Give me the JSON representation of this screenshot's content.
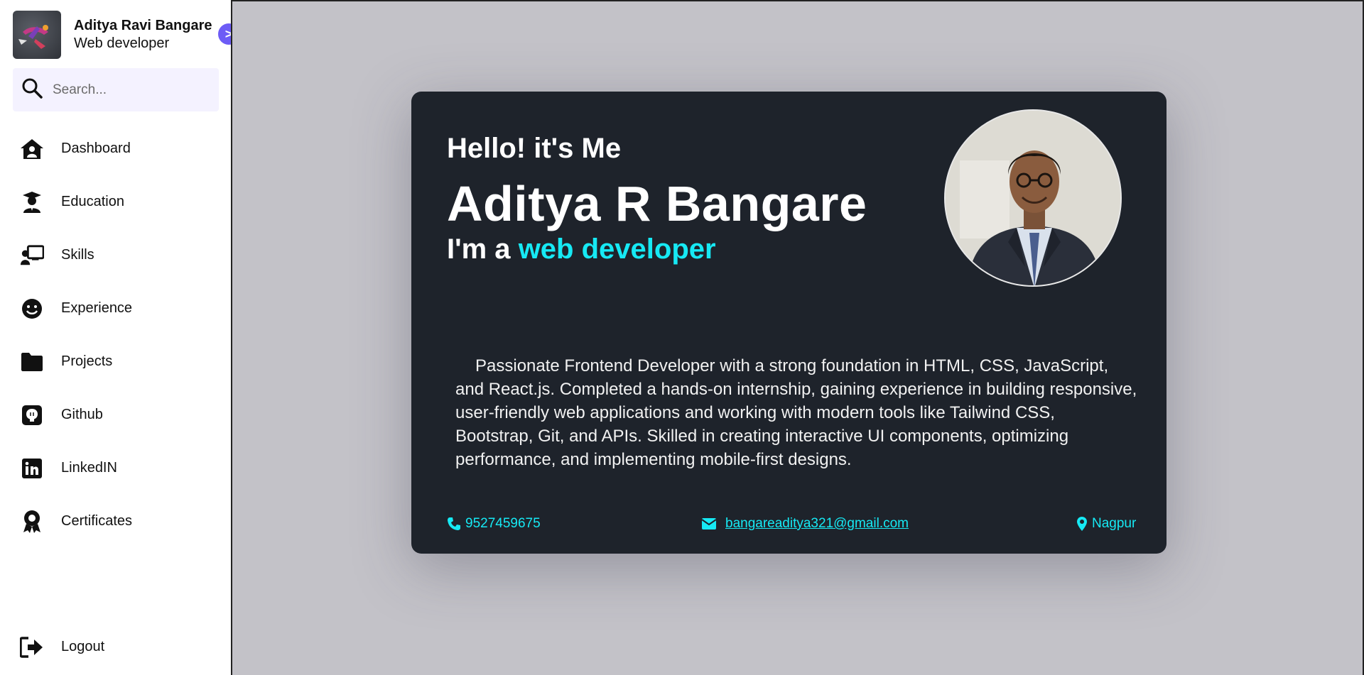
{
  "profile": {
    "name": "Aditya Ravi Bangare",
    "role": "Web developer",
    "toggle": ">"
  },
  "search": {
    "placeholder": "Search...",
    "value": ""
  },
  "nav": {
    "items": [
      {
        "label": "Dashboard",
        "icon": "house-user-icon"
      },
      {
        "label": "Education",
        "icon": "graduate-icon"
      },
      {
        "label": "Skills",
        "icon": "teacher-board-icon"
      },
      {
        "label": "Experience",
        "icon": "smile-icon"
      },
      {
        "label": "Projects",
        "icon": "folder-icon"
      },
      {
        "label": "Github",
        "icon": "github-icon"
      },
      {
        "label": "LinkedIN",
        "icon": "linkedin-icon"
      },
      {
        "label": "Certificates",
        "icon": "award-icon"
      }
    ],
    "logout": "Logout"
  },
  "hero": {
    "greeting": "Hello! it's Me",
    "name": "Aditya R Bangare",
    "tagline_prefix": "I'm a",
    "tagline_accent": "web developer",
    "bio": "Passionate Frontend Developer with a strong foundation in HTML, CSS, JavaScript, and React.js. Completed a hands-on internship, gaining experience in building responsive, user-friendly web applications and working with modern tools like Tailwind CSS, Bootstrap, Git, and APIs. Skilled in creating interactive UI components, optimizing performance, and implementing mobile-first designs."
  },
  "contact": {
    "phone": "9527459675",
    "email": "bangareaditya321@gmail.com",
    "location": "Nagpur"
  },
  "colors": {
    "accent": "#16e9f4",
    "card_bg": "#1e232b",
    "main_bg": "#c3c2c8",
    "search_bg": "#f4f2ff",
    "toggle_bg": "#6d5cf6"
  }
}
